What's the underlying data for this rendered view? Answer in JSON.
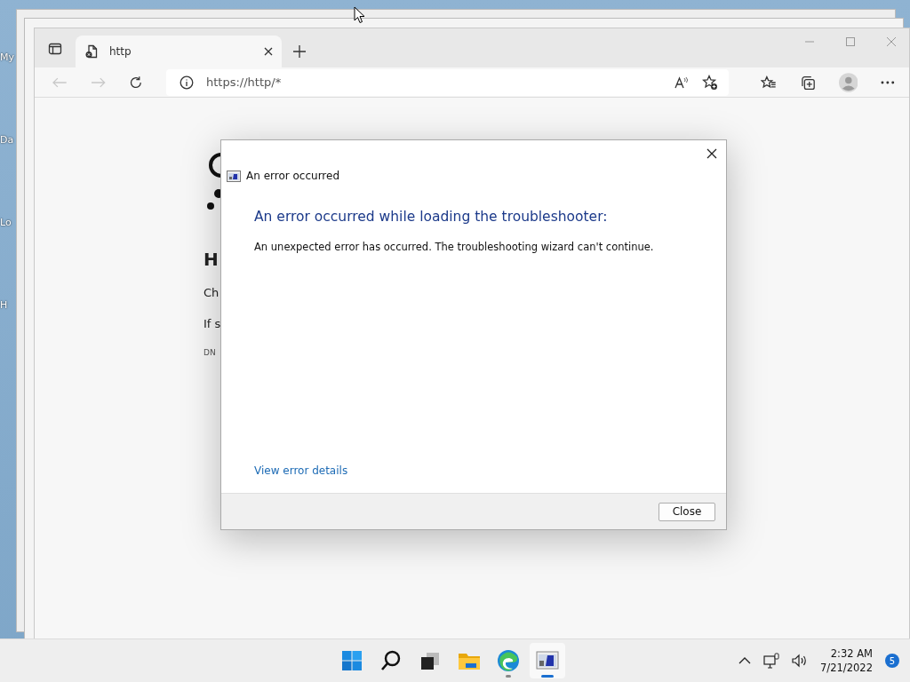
{
  "desktop": {
    "icon_labels": [
      "My",
      "Da",
      "Lo",
      "H"
    ]
  },
  "browser": {
    "tabs": [
      {
        "title": "http",
        "selected": true
      }
    ],
    "address": "https://http/*",
    "page": {
      "texts": [
        {
          "kind": "heading",
          "text": "H"
        },
        {
          "kind": "para",
          "text": "Ch"
        },
        {
          "kind": "para",
          "text": "If s"
        },
        {
          "kind": "code",
          "text": "DN"
        }
      ]
    }
  },
  "dialog": {
    "title": "An error occurred",
    "heading": "An error occurred while loading the troubleshooter:",
    "message": "An unexpected error has occurred. The troubleshooting wizard can't continue.",
    "link": "View error details",
    "buttons": [
      "Close"
    ]
  },
  "taskbar": {
    "apps": [
      {
        "kind": "start",
        "running": false,
        "selected": false
      },
      {
        "kind": "search",
        "running": false,
        "selected": false
      },
      {
        "kind": "taskview",
        "running": false,
        "selected": false
      },
      {
        "kind": "explorer",
        "running": false,
        "selected": false
      },
      {
        "kind": "edge",
        "running": true,
        "selected": false
      },
      {
        "kind": "troubleshooter",
        "running": true,
        "selected": true
      }
    ],
    "clock": {
      "time": "2:32 AM",
      "date": "7/21/2022"
    },
    "notifications": "5"
  }
}
